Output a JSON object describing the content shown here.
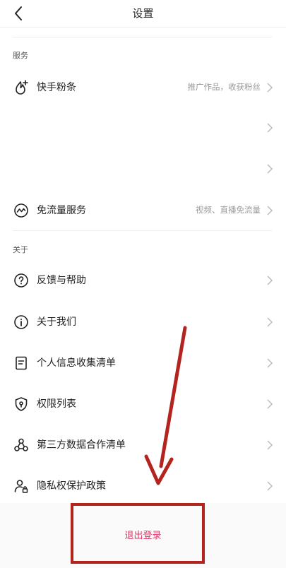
{
  "header": {
    "title": "设置"
  },
  "sections": {
    "service_label": "服务",
    "about_label": "关于"
  },
  "rows": {
    "fans": {
      "label": "快手粉条",
      "desc": "推广作品，收获粉丝"
    },
    "free_data": {
      "label": "免流量服务",
      "desc": "视频、直播免流量"
    },
    "feedback": {
      "label": "反馈与帮助"
    },
    "about_us": {
      "label": "关于我们"
    },
    "personal_info": {
      "label": "个人信息收集清单"
    },
    "permissions": {
      "label": "权限列表"
    },
    "third_party": {
      "label": "第三方数据合作清单"
    },
    "privacy": {
      "label": "隐私权保护政策"
    }
  },
  "logout": {
    "label": "退出登录"
  },
  "colors": {
    "logout_text": "#e0356a",
    "annotation_red": "#b3241f"
  }
}
